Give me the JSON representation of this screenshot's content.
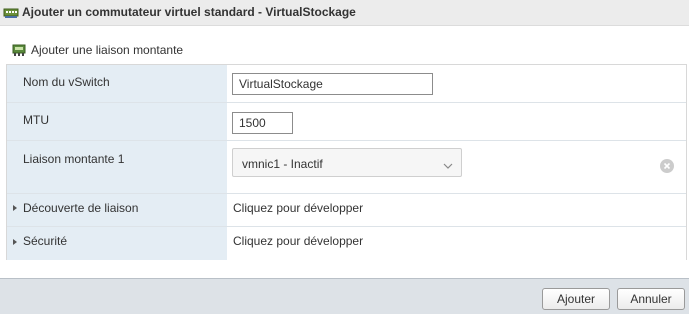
{
  "dialog": {
    "title": "Ajouter un commutateur virtuel standard - VirtualStockage",
    "title_icon": "vswitch-icon"
  },
  "uplink_action": {
    "label": "Ajouter une liaison montante",
    "icon": "network-card-icon"
  },
  "form": {
    "vswitch_name": {
      "label": "Nom du vSwitch",
      "value": "VirtualStockage"
    },
    "mtu": {
      "label": "MTU",
      "value": "1500"
    },
    "uplink1": {
      "label": "Liaison montante 1",
      "selected": "vmnic1 - Inactif",
      "remove_icon": "remove-circle-icon"
    },
    "link_discovery": {
      "label": "Découverte de liaison",
      "value": "Cliquez pour développer"
    },
    "security": {
      "label": "Sécurité",
      "value": "Cliquez pour développer"
    }
  },
  "footer": {
    "add_label": "Ajouter",
    "cancel_label": "Annuler"
  },
  "colors": {
    "label_column": "#e4edf4",
    "footer": "#dde2e7",
    "titlebar": "#ececec"
  }
}
